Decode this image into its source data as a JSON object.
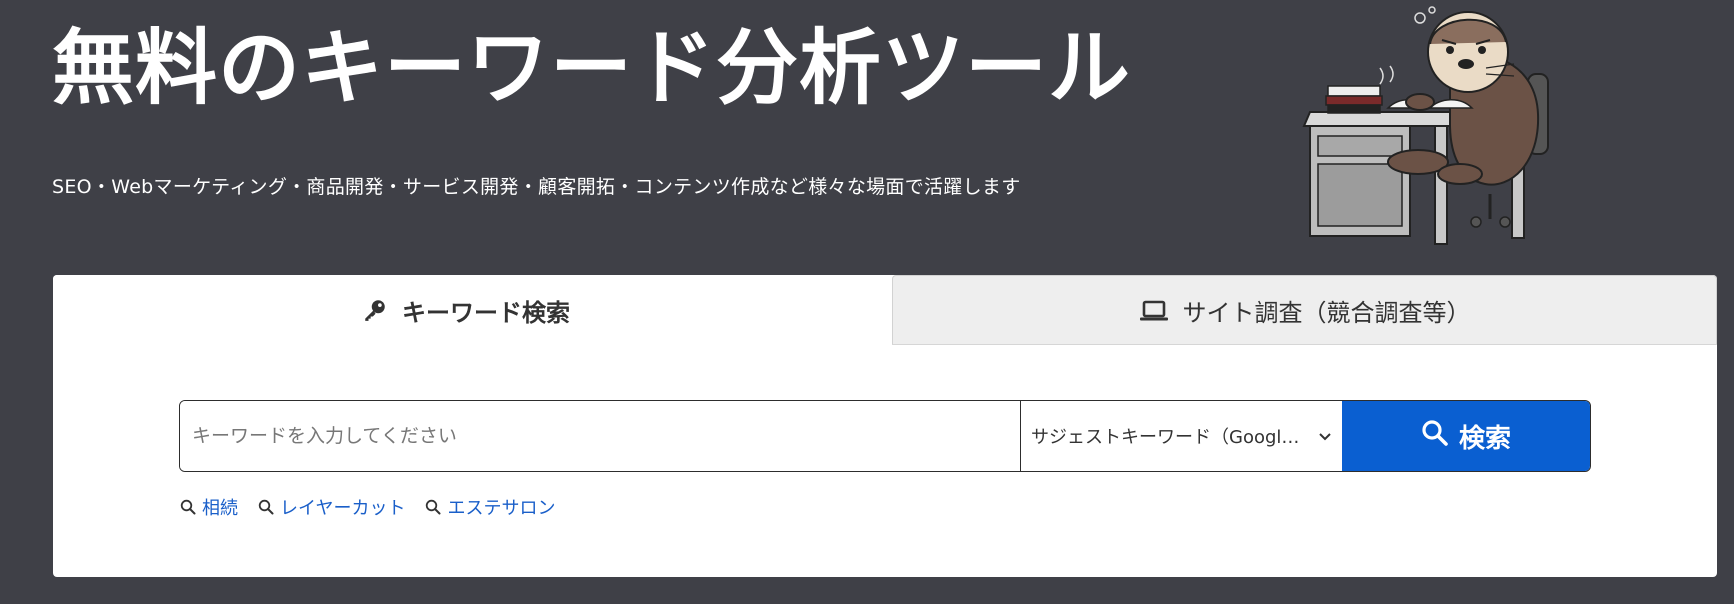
{
  "hero": {
    "title": "無料のキーワード分析ツール",
    "subtitle": "SEO・Webマーケティング・商品開発・サービス開発・顧客開拓・コンテンツ作成など様々な場面で活躍します"
  },
  "tabs": [
    {
      "label": "キーワード検索",
      "icon": "key-icon",
      "active": true
    },
    {
      "label": "サイト調査（競合調査等）",
      "icon": "laptop-icon",
      "active": false
    }
  ],
  "search": {
    "input_value": "",
    "placeholder": "キーワードを入力してください",
    "select_value": "サジェストキーワード（Google）",
    "select_display": "サジェストキーワード（Googl…",
    "button_label": "検索"
  },
  "suggestions": [
    "相続",
    "レイヤーカット",
    "エステサロン"
  ],
  "colors": {
    "background": "#3f4047",
    "accent": "#0a5fd1",
    "link": "#1a5fc9",
    "inactive_tab": "#eeeeee"
  }
}
